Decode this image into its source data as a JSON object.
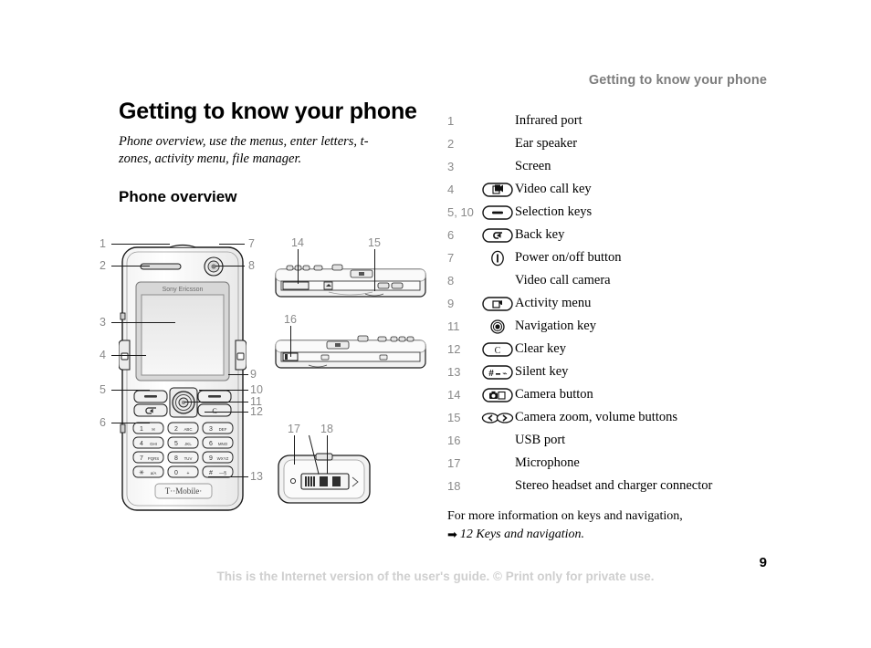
{
  "header": {
    "running_title": "Getting to know your phone"
  },
  "content": {
    "chapter_title": "Getting to know your phone",
    "chapter_intro": "Phone overview, use the menus, enter letters, t-zones, activity menu, file manager.",
    "section_title": "Phone overview"
  },
  "figure": {
    "phone_brand": "Sony Ericsson",
    "carrier_logo": "T··Mobile·",
    "callouts": [
      "1",
      "2",
      "3",
      "4",
      "5",
      "6",
      "7",
      "8",
      "9",
      "10",
      "11",
      "12",
      "13",
      "14",
      "15",
      "16",
      "17",
      "18"
    ],
    "keypad": [
      [
        "1",
        "✉"
      ],
      [
        "2",
        "ABC"
      ],
      [
        "3",
        "DEF"
      ],
      [
        "4",
        "GHI"
      ],
      [
        "5",
        "JKL"
      ],
      [
        "6",
        "MNO"
      ],
      [
        "7",
        "PQRS"
      ],
      [
        "8",
        "TUV"
      ],
      [
        "9",
        "WXYZ"
      ],
      [
        "∗",
        "a/A→"
      ],
      [
        "0",
        "+"
      ],
      [
        "#",
        "—§"
      ]
    ],
    "clear_key_label": "C"
  },
  "legend": {
    "rows": [
      {
        "num": "1",
        "icon": "",
        "label": "Infrared port"
      },
      {
        "num": "2",
        "icon": "",
        "label": "Ear speaker"
      },
      {
        "num": "3",
        "icon": "",
        "label": "Screen"
      },
      {
        "num": "4",
        "icon": "video-call-key-icon",
        "label": "Video call key"
      },
      {
        "num": "5, 10",
        "icon": "selection-key-icon",
        "label": "Selection keys"
      },
      {
        "num": "6",
        "icon": "back-key-icon",
        "label": "Back key"
      },
      {
        "num": "7",
        "icon": "power-button-icon",
        "label": "Power on/off button"
      },
      {
        "num": "8",
        "icon": "",
        "label": "Video call camera"
      },
      {
        "num": "9",
        "icon": "activity-menu-icon",
        "label": "Activity menu"
      },
      {
        "num": "11",
        "icon": "navigation-key-icon",
        "label": "Navigation key"
      },
      {
        "num": "12",
        "icon": "clear-key-icon",
        "label": "Clear key"
      },
      {
        "num": "13",
        "icon": "silent-key-icon",
        "label": "Silent key"
      },
      {
        "num": "14",
        "icon": "camera-button-icon",
        "label": "Camera button"
      },
      {
        "num": "15",
        "icon": "camera-zoom-icon",
        "label": "Camera zoom, volume buttons"
      },
      {
        "num": "16",
        "icon": "",
        "label": "USB port"
      },
      {
        "num": "17",
        "icon": "",
        "label": "Microphone"
      },
      {
        "num": "18",
        "icon": "",
        "label": "Stereo headset and charger connector"
      }
    ],
    "note_line1": "For more information on keys and navigation,",
    "note_arrow": "➡",
    "note_reference": "12 Keys and navigation."
  },
  "footer": {
    "disclaimer": "This is the Internet version of the user's guide. © Print only for private use.",
    "page_number": "9"
  },
  "colors": {
    "callout_gray": "#8a8a8a",
    "header_gray": "#7d7d7d",
    "footer_gray": "#cfcfcf",
    "ink": "#000000"
  }
}
